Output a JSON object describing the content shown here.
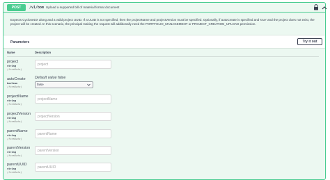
{
  "operation": {
    "method": "POST",
    "path": "/v1/bom",
    "summary": "Upload a supported bill of material format document",
    "description": "Expects CycloneDX along and a valid project UUID. If a UUID is not specified, then the projectName and projectVersion must be specified. Optionally, if autoCreate is specified and 'true' and the project does not exist, the project will be created. In this scenario, the principal making the request will additionally need the PORTFOLIO_MANAGEMENT or PROJECT_CREATION_UPLOAD permission.",
    "lock_icon": "lock-icon",
    "chevron_icon": "chevron-up-icon"
  },
  "parameters": {
    "title": "Parameters",
    "try_it_out_label": "Try it out",
    "col_name": "Name",
    "col_description": "Description",
    "items": [
      {
        "name": "project",
        "type": "string",
        "in": "(formData)",
        "placeholder": "project"
      },
      {
        "name": "autoCreate",
        "type": "boolean",
        "in": "(formData)",
        "default_label": "Default value",
        "default_value": "false",
        "selected": "false"
      },
      {
        "name": "projectName",
        "type": "string",
        "in": "(formData)",
        "placeholder": "projectName"
      },
      {
        "name": "projectVersion",
        "type": "string",
        "in": "(formData)",
        "placeholder": "projectVersion"
      },
      {
        "name": "parentName",
        "type": "string",
        "in": "(formData)",
        "placeholder": "parentName"
      },
      {
        "name": "parentVersion",
        "type": "string",
        "in": "(formData)",
        "placeholder": "parentVersion"
      },
      {
        "name": "parentUUID",
        "type": "string",
        "in": "(formData)",
        "placeholder": "parentUUID"
      }
    ]
  },
  "colors": {
    "accent": "#49cc90",
    "background": "#ecf8f1"
  }
}
